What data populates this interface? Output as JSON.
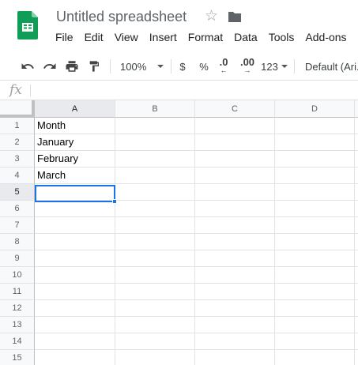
{
  "document": {
    "title": "Untitled spreadsheet",
    "star_icon": "star-outline-icon",
    "folder_icon": "folder-icon",
    "logo_icon": "google-sheets-logo-icon"
  },
  "menu": {
    "items": [
      "File",
      "Edit",
      "View",
      "Insert",
      "Format",
      "Data",
      "Tools",
      "Add-ons"
    ]
  },
  "toolbar": {
    "undo_icon": "undo-icon",
    "redo_icon": "redo-icon",
    "print_icon": "print-icon",
    "paint_format_icon": "paint-format-icon",
    "zoom": "100%",
    "currency": "$",
    "percent": "%",
    "decrease_decimal": ".0",
    "increase_decimal": ".00",
    "more_formats": "123",
    "font": "Default (Ari..."
  },
  "formula_bar": {
    "fx_label": "fx",
    "value": ""
  },
  "grid": {
    "columns": [
      "A",
      "B",
      "C",
      "D"
    ],
    "rows": [
      "1",
      "2",
      "3",
      "4",
      "5",
      "6",
      "7",
      "8",
      "9",
      "10",
      "11",
      "12",
      "13",
      "14",
      "15"
    ],
    "cells": [
      [
        "Month",
        "",
        "",
        ""
      ],
      [
        "January",
        "",
        "",
        ""
      ],
      [
        "February",
        "",
        "",
        ""
      ],
      [
        "March",
        "",
        "",
        ""
      ],
      [
        "",
        "",
        "",
        ""
      ],
      [
        "",
        "",
        "",
        ""
      ],
      [
        "",
        "",
        "",
        ""
      ],
      [
        "",
        "",
        "",
        ""
      ],
      [
        "",
        "",
        "",
        ""
      ],
      [
        "",
        "",
        "",
        ""
      ],
      [
        "",
        "",
        "",
        ""
      ],
      [
        "",
        "",
        "",
        ""
      ],
      [
        "",
        "",
        "",
        ""
      ],
      [
        "",
        "",
        "",
        ""
      ],
      [
        "",
        "",
        "",
        ""
      ]
    ],
    "selected_cell": "A5",
    "selected_row": "5",
    "selected_column": "A"
  },
  "colors": {
    "accent": "#1a73e8",
    "sheets_green": "#0f9d58"
  }
}
